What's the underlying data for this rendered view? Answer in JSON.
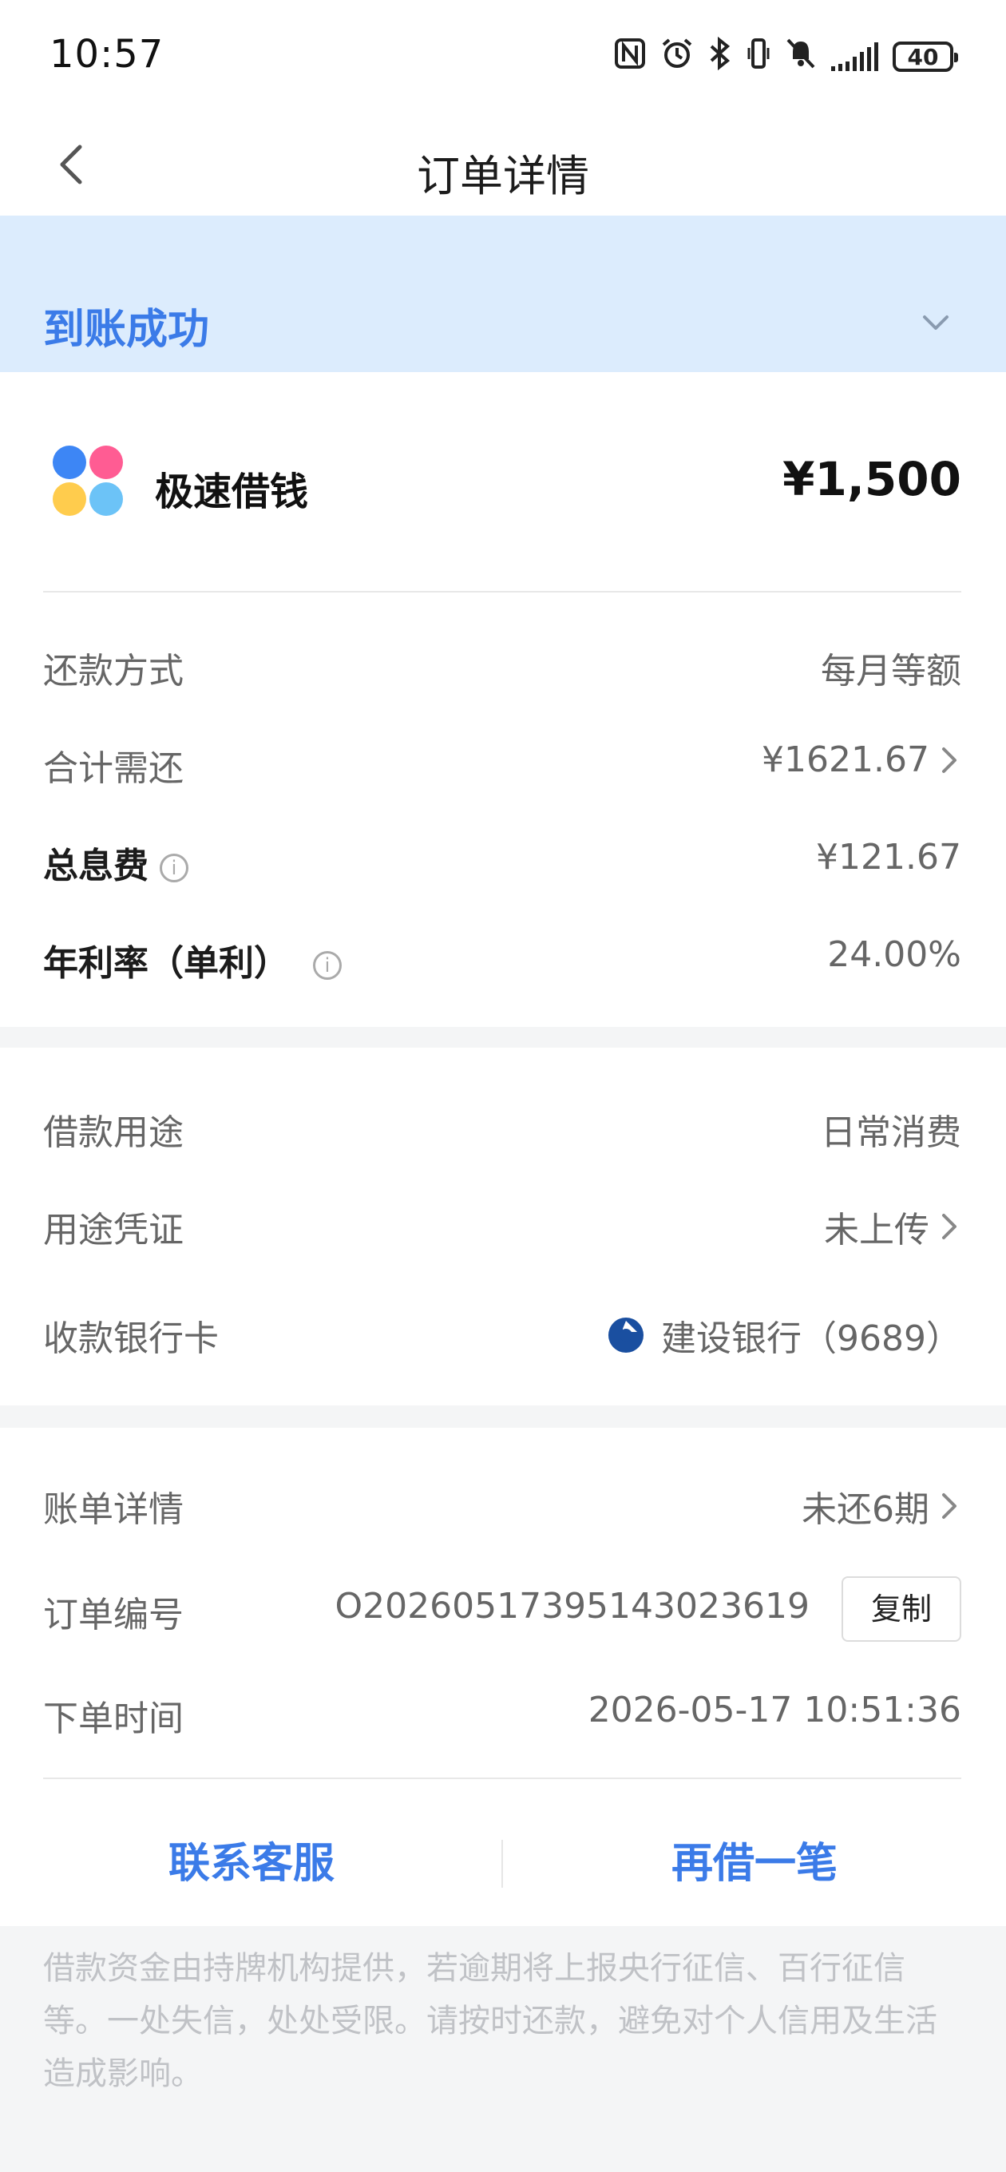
{
  "status_bar": {
    "time": "10:57",
    "battery": "40",
    "icons": [
      "nfc-icon",
      "alarm-icon",
      "bluetooth-icon",
      "vibrate-icon",
      "mute-icon",
      "signal-icon",
      "battery-icon"
    ]
  },
  "nav": {
    "title": "订单详情"
  },
  "banner": {
    "title": "到账成功"
  },
  "product": {
    "name": "极速借钱",
    "amount": "¥1,500"
  },
  "loan_terms": {
    "repay_method_label": "还款方式",
    "repay_method_value": "每月等额",
    "total_repay_label": "合计需还",
    "total_repay_value": "¥1621.67",
    "total_interest_label": "总息费",
    "total_interest_value": "¥121.67",
    "annual_rate_label": "年利率（单利）",
    "annual_rate_value": "24.00%"
  },
  "loan_info": {
    "purpose_label": "借款用途",
    "purpose_value": "日常消费",
    "proof_label": "用途凭证",
    "proof_value": "未上传",
    "card_label": "收款银行卡",
    "card_value": "建设银行（9689）"
  },
  "order_info": {
    "bill_label": "账单详情",
    "bill_value": "未还6期",
    "order_no_label": "订单编号",
    "order_no_value": "O20260517395143023619",
    "copy_label": "复制",
    "order_time_label": "下单时间",
    "order_time_value": "2026-05-17 10:51:36"
  },
  "actions": {
    "contact_label": "联系客服",
    "borrow_again_label": "再借一笔"
  },
  "disclaimer": "借款资金由持牌机构提供，若逾期将上报央行征信、百行征信等。一处失信，处处受限。请按时还款，避免对个人信用及生活造成影响。",
  "colors": {
    "accent": "#3b7be8",
    "banner_bg": "#dcecfd",
    "logo_blue": "#3d86f5",
    "logo_pink": "#ff5c93",
    "logo_yellow": "#ffcc4d",
    "logo_lightblue": "#6cc3f7",
    "bank_blue": "#1a4fa0"
  }
}
